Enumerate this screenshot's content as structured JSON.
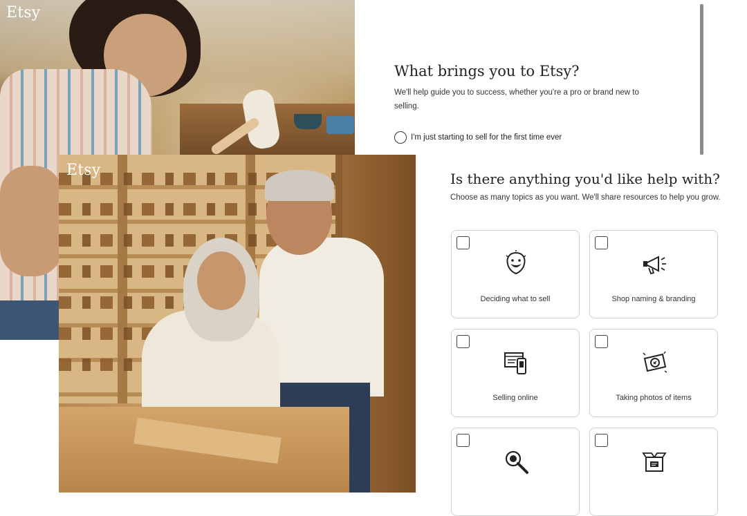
{
  "back_screen": {
    "logo": "Etsy",
    "title": "What brings you to Etsy?",
    "subtitle": "We'll help guide you to success, whether you're a pro or brand new to selling.",
    "option": "I'm just starting to sell for the first time ever"
  },
  "front_screen": {
    "logo": "Etsy",
    "title": "Is there anything you'd like help with?",
    "subtitle": "Choose as many topics as you want. We'll share resources to help you grow.",
    "topics": [
      {
        "label": "Deciding what to sell",
        "icon": "lightbulb-face-icon",
        "checked": false
      },
      {
        "label": "Shop naming & branding",
        "icon": "megaphone-icon",
        "checked": false
      },
      {
        "label": "Selling online",
        "icon": "devices-icon",
        "checked": false
      },
      {
        "label": "Taking photos of items",
        "icon": "camera-icon",
        "checked": false
      },
      {
        "label": "",
        "icon": "magnifier-icon",
        "checked": false
      },
      {
        "label": "",
        "icon": "shipping-box-icon",
        "checked": false
      }
    ]
  }
}
